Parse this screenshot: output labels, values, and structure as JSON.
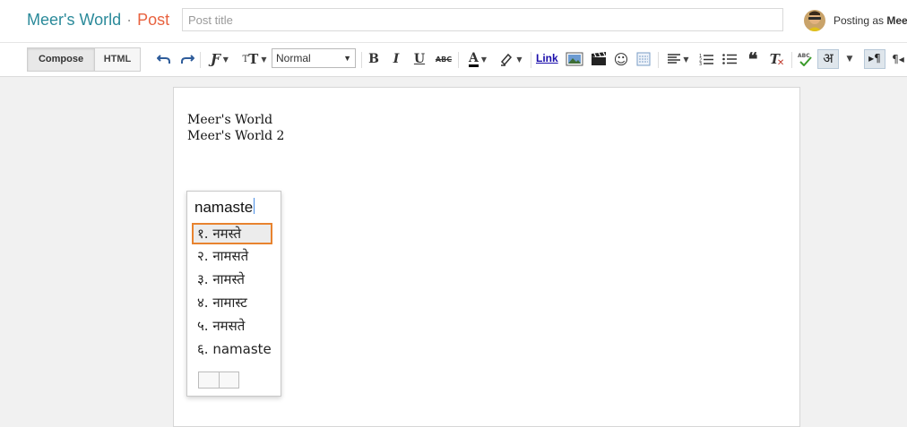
{
  "header": {
    "blog_title": "Meer's World",
    "separator": "·",
    "page_label": "Post",
    "title_placeholder": "Post title",
    "posting_as_prefix": "Posting as",
    "posting_as_user": "Mee"
  },
  "toolbar": {
    "compose_label": "Compose",
    "html_label": "HTML",
    "format_value": "Normal",
    "link_label": "Link",
    "hindi_glyph": "अ",
    "icons": [
      "undo-icon",
      "redo-icon",
      "font-icon",
      "font-size-icon",
      "bold-icon",
      "italic-icon",
      "underline-icon",
      "strikethrough-icon",
      "text-color-icon",
      "highlight-icon",
      "image-icon",
      "video-icon",
      "emoji-icon",
      "jump-break-icon",
      "align-icon",
      "numbered-list-icon",
      "bulleted-list-icon",
      "quote-icon",
      "remove-format-icon",
      "spellcheck-icon",
      "hindi-input-icon",
      "ltr-icon",
      "rtl-icon"
    ]
  },
  "editor": {
    "lines": [
      "Meer's World",
      "Meer's World 2"
    ]
  },
  "transliteration": {
    "typed": "namaste",
    "selected_index": 0,
    "candidates": [
      "१. नमस्ते",
      "२. नामसते",
      "३. नामस्ते",
      "४. नामास्ट",
      "५. नमसते",
      "६. namaste"
    ]
  },
  "colors": {
    "brand": "#2b8a9a",
    "accent": "#e8623f",
    "selection_border": "#e8832f",
    "link": "#1a0dab"
  }
}
